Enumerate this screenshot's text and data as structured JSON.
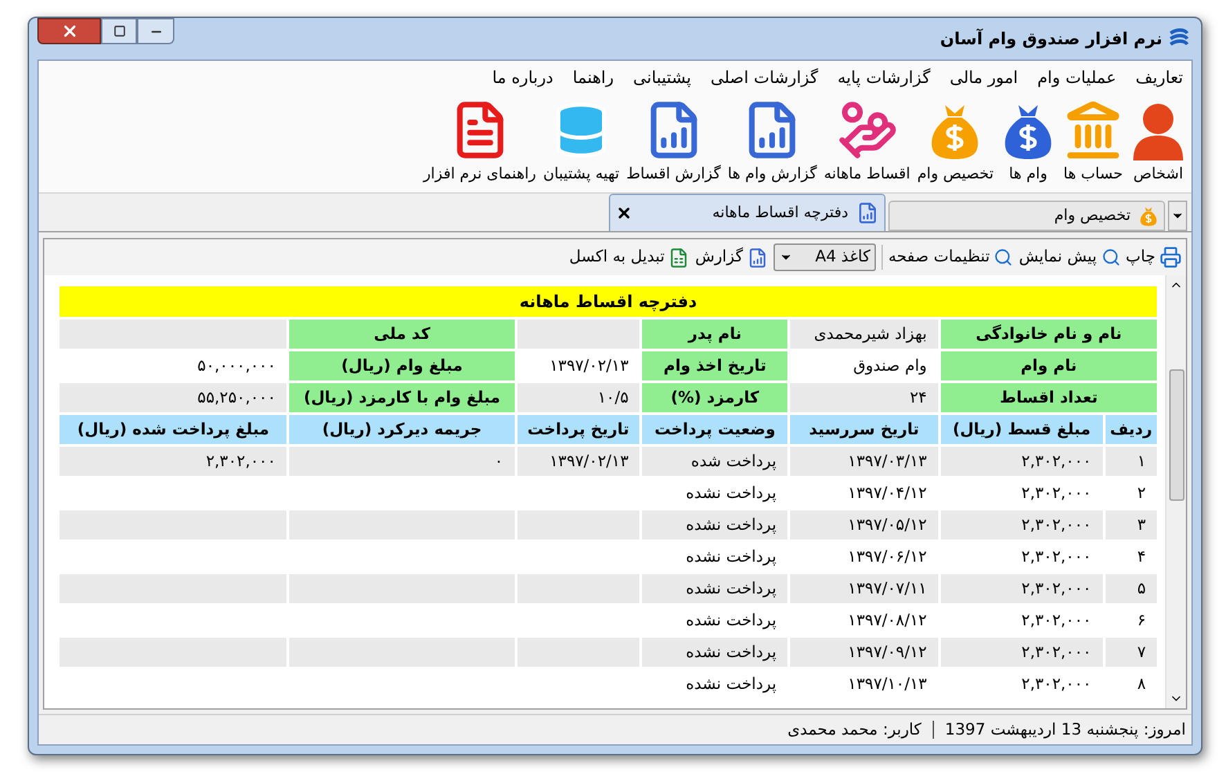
{
  "window": {
    "title": "نرم افزار صندوق وام آسان"
  },
  "menu": [
    "تعاریف",
    "عملیات وام",
    "امور مالی",
    "گزارشات پایه",
    "گزارشات اصلی",
    "پشتیبانی",
    "راهنما",
    "درباره ما"
  ],
  "ribbon": [
    "اشخاص",
    "حساب ها",
    "وام ها",
    "تخصیص وام",
    "اقساط ماهانه",
    "گزارش وام ها",
    "گزارش اقساط",
    "تهیه پشتیبان",
    "راهنمای نرم افزار"
  ],
  "tabs": [
    {
      "label": "تخصیص وام",
      "selected": false
    },
    {
      "label": "دفترچه اقساط ماهانه",
      "selected": true
    }
  ],
  "toolbar": {
    "print": "چاپ",
    "preview": "پیش نمایش",
    "page_setup": "تنظیمات صفحه",
    "paper": "کاغذ A4",
    "report": "گزارش",
    "excel": "تبدیل به اکسل"
  },
  "report": {
    "title": "دفترچه اقساط ماهانه",
    "info": [
      [
        {
          "label": "نام و نام خانوادگی",
          "value": "بهزاد شیرمحمدی"
        },
        {
          "label": "نام پدر"
        },
        {
          "label": "کد ملی"
        }
      ],
      [
        {
          "label": "نام وام",
          "value": "وام صندوق"
        },
        {
          "label": "تاریخ اخذ وام",
          "value": "۱۳۹۷/۰۲/۱۳"
        },
        {
          "label": "مبلغ وام (ریال)",
          "value": "۵۰,۰۰۰,۰۰۰"
        }
      ],
      [
        {
          "label": "تعداد اقساط",
          "value": "۲۴"
        },
        {
          "label": "کارمزد (%)",
          "value": "۱۰/۵"
        },
        {
          "label": "مبلغ وام با کارمزد (ریال)",
          "value": "۵۵,۲۵۰,۰۰۰"
        }
      ]
    ],
    "columns": [
      "ردیف",
      "مبلغ قسط (ریال)",
      "تاریخ سررسید",
      "وضعیت پرداخت",
      "تاریخ پرداخت",
      "جریمه دیرکرد (ریال)",
      "مبلغ پرداخت شده (ریال)"
    ],
    "rows": [
      {
        "cells": [
          "۱",
          "۲,۳۰۲,۰۰۰",
          "۱۳۹۷/۰۳/۱۳",
          "پرداخت شده",
          "۱۳۹۷/۰۲/۱۳",
          "۰",
          "۲,۳۰۲,۰۰۰"
        ]
      },
      {
        "cells": [
          "۲",
          "۲,۳۰۲,۰۰۰",
          "۱۳۹۷/۰۴/۱۲",
          "پرداخت نشده"
        ]
      },
      {
        "cells": [
          "۳",
          "۲,۳۰۲,۰۰۰",
          "۱۳۹۷/۰۵/۱۲",
          "پرداخت نشده"
        ]
      },
      {
        "cells": [
          "۴",
          "۲,۳۰۲,۰۰۰",
          "۱۳۹۷/۰۶/۱۲",
          "پرداخت نشده"
        ]
      },
      {
        "cells": [
          "۵",
          "۲,۳۰۲,۰۰۰",
          "۱۳۹۷/۰۷/۱۱",
          "پرداخت نشده"
        ]
      },
      {
        "cells": [
          "۶",
          "۲,۳۰۲,۰۰۰",
          "۱۳۹۷/۰۸/۱۲",
          "پرداخت نشده"
        ]
      },
      {
        "cells": [
          "۷",
          "۲,۳۰۲,۰۰۰",
          "۱۳۹۷/۰۹/۱۲",
          "پرداخت نشده"
        ]
      },
      {
        "cells": [
          "۸",
          "۲,۳۰۲,۰۰۰",
          "۱۳۹۷/۱۰/۱۳",
          "پرداخت نشده"
        ]
      }
    ]
  },
  "status_bar": {
    "date": "امروز: پنجشنبه 13 اردیبهشت 1397",
    "user": "کاربر: محمد محمدی"
  }
}
